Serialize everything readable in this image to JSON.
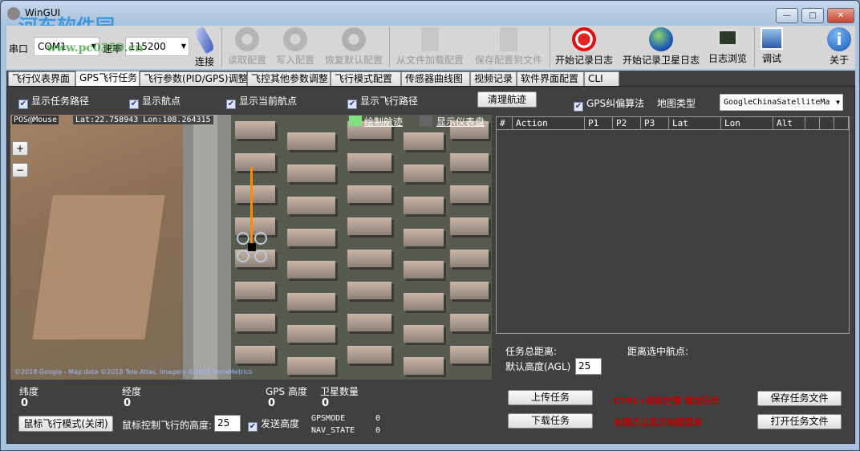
{
  "window": {
    "title": "WinGUI",
    "min": "—",
    "max": "□",
    "close": "✕",
    "watermark": "河东软件园",
    "watermark_url": "www.pc0359.cn"
  },
  "toolbar": {
    "port_label": "串口",
    "port_value": "COM1",
    "baud_label": "速率",
    "baud_value": "115200",
    "buttons": [
      {
        "label": "连接",
        "icon": "plug-icon",
        "enabled": true
      },
      {
        "label": "读取配置",
        "icon": "gear-icon",
        "enabled": false
      },
      {
        "label": "写入配置",
        "icon": "gear-icon",
        "enabled": false
      },
      {
        "label": "恢复默认配置",
        "icon": "restore-icon",
        "enabled": false
      },
      {
        "label": "从文件加载配置",
        "icon": "file-load-icon",
        "enabled": false
      },
      {
        "label": "保存配置到文件",
        "icon": "file-save-icon",
        "enabled": false
      },
      {
        "label": "开始记录日志",
        "icon": "record-icon",
        "enabled": true
      },
      {
        "label": "开始记录卫星日志",
        "icon": "globe-icon",
        "enabled": true
      },
      {
        "label": "日志浏览",
        "icon": "monitor-icon",
        "enabled": true
      },
      {
        "label": "调试",
        "icon": "picture-icon",
        "enabled": true
      },
      {
        "label": "关于",
        "icon": "info-icon",
        "enabled": true
      }
    ]
  },
  "tabs": [
    "飞行仪表界面",
    "GPS飞行任务",
    "飞行参数(PID/GPS)调整",
    "飞控其他参数调整",
    "飞行模式配置",
    "传感器曲线图",
    "视频记录",
    "软件界面配置",
    "CLI"
  ],
  "active_tab": 1,
  "options": {
    "show_mission_path": "显示任务路径",
    "show_waypoints": "显示航点",
    "show_current_wp": "显示当前航点",
    "show_flight_path": "显示飞行路径",
    "clear_track": "清理航迹",
    "gps_correction": "GPS纠偏算法",
    "map_type_label": "地图类型",
    "map_type_value": "GoogleChinaSatelliteMa"
  },
  "map": {
    "pos_label": "POS@Mouse",
    "lat_lon": "Lat:22.758943 Lon:108.264315",
    "draw_track": "绘制航迹",
    "show_dashboard": "显示仪表盘",
    "zoom_in": "+",
    "zoom_out": "−",
    "copyright": "©2018 Google - Map data ©2018 Tele Atlas, Imagery ©2018 TerraMetrics",
    "track_color": "#ff8c00"
  },
  "grid": {
    "columns": [
      "#",
      "Action",
      "P1",
      "P2",
      "P3",
      "Lat",
      "Lon",
      "Alt",
      "",
      "",
      ""
    ],
    "rows": []
  },
  "mission": {
    "total_distance": "任务总距离:",
    "dist_selected": "距离选中航点:",
    "default_alt_label": "默认高度(AGL)",
    "default_alt": "25",
    "upload": "上传任务",
    "download": "下载任务",
    "hint1": "CTRL+鼠标左键  增加任务",
    "hint2": "右键点击显示地图菜单",
    "save_file": "保存任务文件",
    "open_file": "打开任务文件"
  },
  "status": {
    "lat_label": "纬度",
    "lat": "0",
    "lon_label": "经度",
    "lon": "0",
    "gps_alt_label": "GPS 高度",
    "gps_alt": "0",
    "sats_label": "卫星数量",
    "sats": "0",
    "mouse_fly_btn": "鼠标飞行模式(关闭)",
    "mouse_alt_label": "鼠标控制飞行的高度:",
    "mouse_alt": "25",
    "send_alt": "发送高度",
    "gpsmode_label": "GPSMODE",
    "gpsmode": "0",
    "navstate_label": "NAV_STATE",
    "navstate": "0"
  }
}
